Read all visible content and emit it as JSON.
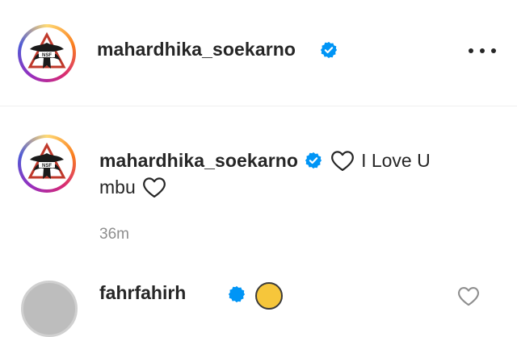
{
  "post_header": {
    "username": "mahardhika_soekarno",
    "verified": true,
    "more_icon": "more-horizontal-icon"
  },
  "comments": [
    {
      "username": "mahardhika_soekarno",
      "verified": true,
      "text_line1": "I Love U",
      "text_line2": "mbu",
      "timestamp": "36m"
    }
  ],
  "next_comment": {
    "username_partial": "fahrfahirh"
  },
  "colors": {
    "verified_blue": "#0095f6",
    "text": "#262626",
    "secondary_text": "#8e8e8e",
    "divider": "#efefef"
  }
}
